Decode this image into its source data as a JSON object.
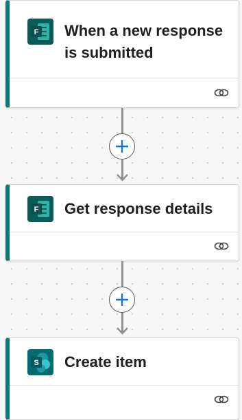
{
  "flow": {
    "steps": [
      {
        "title": "When a new response is submitted",
        "icon": "microsoft-forms-icon",
        "accent": "#0c7a7a"
      },
      {
        "title": "Get response details",
        "icon": "microsoft-forms-icon",
        "accent": "#0c7a7a"
      },
      {
        "title": "Create item",
        "icon": "sharepoint-icon",
        "accent": "#0c7a7a"
      }
    ],
    "connector_icon": "link-icon",
    "add_step_icon": "plus-icon"
  }
}
